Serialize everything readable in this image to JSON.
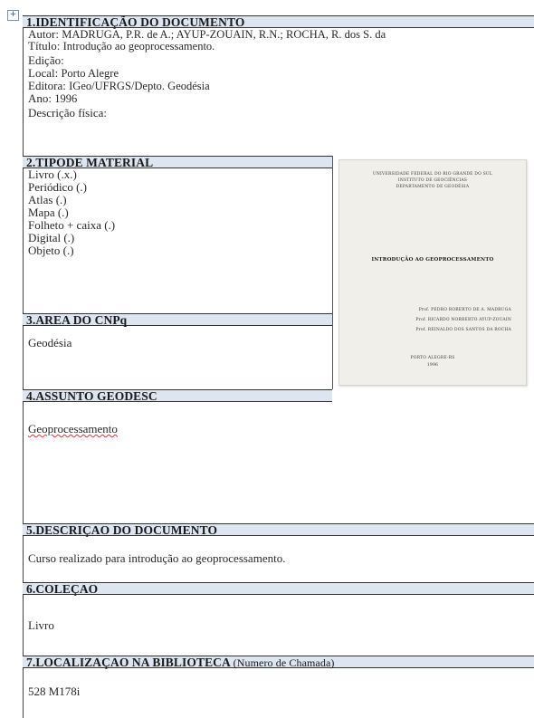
{
  "anchor_symbol": "+",
  "section1": {
    "header": "1.IDENTIFICAÇÃO DO DOCUMENTO",
    "autor_label": "Autor:",
    "autor_value": "MADRUGA, P.R. de A.; AYUP-ZOUAIN, R.N.; ROCHA, R. dos S. da",
    "titulo_label": "Título:",
    "titulo_value": "Introdução ao geoprocessamento.",
    "edicao_label": "Edição:",
    "edicao_value": "",
    "local_label": "Local:",
    "local_value": "Porto Alegre",
    "editora_label": "Editora:",
    "editora_value": "IGeo/UFRGS/Depto. Geodésia",
    "ano_label": "Ano:",
    "ano_value": "1996",
    "descricao_label": "Descrição física:"
  },
  "section2": {
    "header": "2.TIPODE MATERIAL",
    "items": [
      "Livro (.x.)",
      "Periódico (.)",
      "Atlas (.)",
      "Mapa (.)",
      "Folheto + caixa (.)",
      "Digital (.)",
      "Objeto (.)"
    ]
  },
  "section3": {
    "header": "3.AREA DO CNPq",
    "value": "Geodésia"
  },
  "section4": {
    "header": "4.ASSUNTO GEODESC",
    "value": "Geoprocessamento"
  },
  "section5": {
    "header": "5.DESCRIÇAO DO DOCUMENTO",
    "value": "Curso realizado para introdução ao geoprocessamento."
  },
  "section6": {
    "header": "6.COLEÇAO",
    "value": "Livro"
  },
  "section7": {
    "header": "7.LOCALIZAÇAO NA BIBLIOTECA",
    "subheader": "(Numero de Chamada)",
    "value": "528 M178i"
  },
  "cover": {
    "institution_lines": [
      "UNIVERSIDADE FEDERAL DO RIO GRANDE DO SUL",
      "INSTITUTO DE GEOCIÊNCIAS",
      "DEPARTAMENTO DE GEODÉSIA"
    ],
    "title": "INTRODUÇÃO AO GEOPROCESSAMENTO",
    "authors": [
      "Prof. PEDRO ROBERTO DE A. MADRUGA",
      "Prof. RICARDO NORBERTO AYUP-ZOUAIN",
      "Prof. REINALDO DOS SANTOS DA ROCHA"
    ],
    "city": "PORTO ALEGRE-RS",
    "year": "1996"
  }
}
